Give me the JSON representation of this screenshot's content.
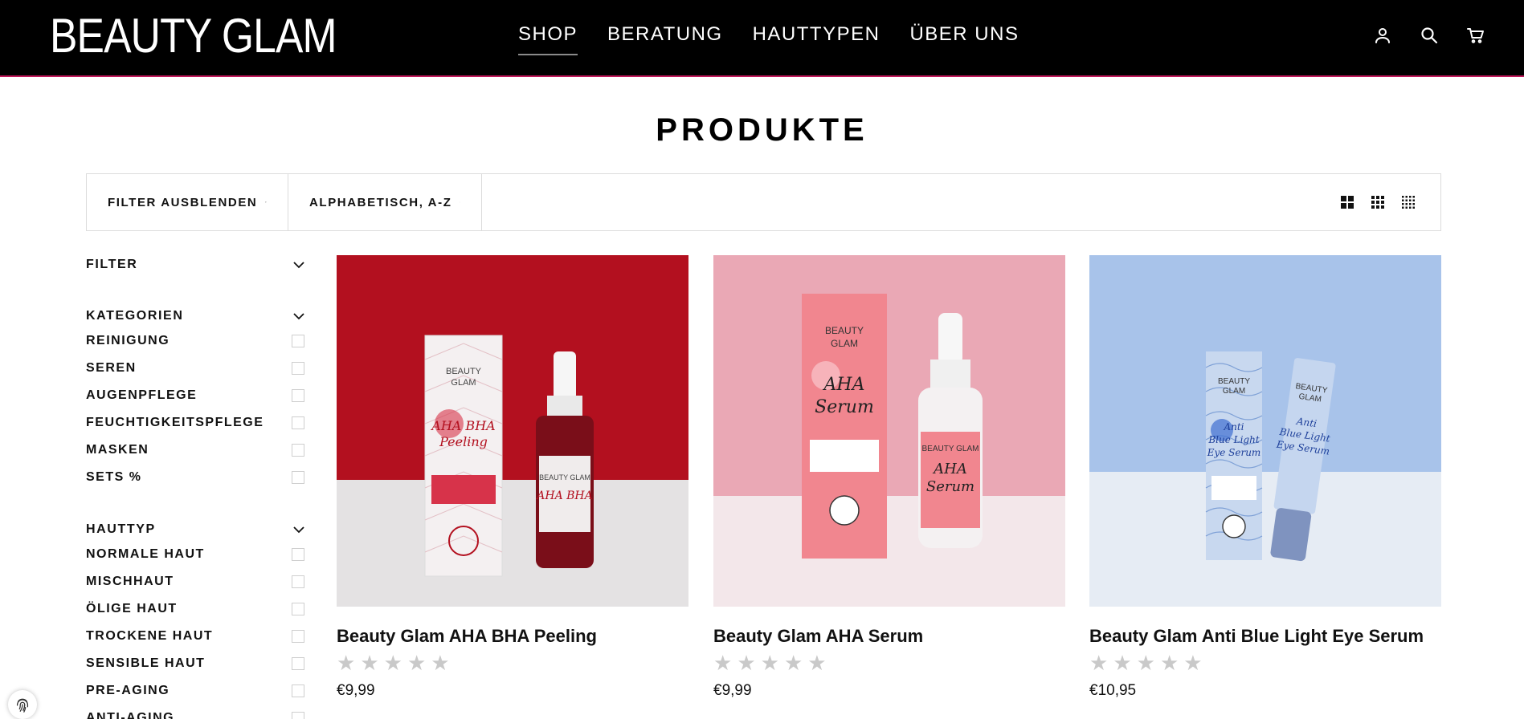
{
  "brand": {
    "logo": "BEAUTY GLAM"
  },
  "nav": {
    "items": [
      {
        "label": "SHOP",
        "active": true
      },
      {
        "label": "BERATUNG"
      },
      {
        "label": "HAUTTYPEN"
      },
      {
        "label": "ÜBER UNS"
      }
    ]
  },
  "header_icons": [
    "account-icon",
    "search-icon",
    "cart-icon"
  ],
  "page": {
    "title": "PRODUKTE"
  },
  "toolbar": {
    "filter_label": "FILTER AUSBLENDEN",
    "sort_label": "ALPHABETISCH, A-Z",
    "grid_options": [
      "grid-large-icon",
      "grid-medium-icon",
      "grid-small-icon"
    ]
  },
  "sidebar": {
    "filter_heading": "FILTER",
    "categories": {
      "heading": "KATEGORIEN",
      "items": [
        "REINIGUNG",
        "SEREN",
        "AUGENPFLEGE",
        "FEUCHTIGKEITSPFLEGE",
        "MASKEN",
        "SETS %"
      ]
    },
    "skin_type": {
      "heading": "HAUTTYP",
      "items": [
        "NORMALE HAUT",
        "MISCHHAUT",
        "ÖLIGE HAUT",
        "TROCKENE HAUT",
        "SENSIBLE HAUT",
        "PRE-AGING",
        "ANTI-AGING"
      ]
    }
  },
  "products": [
    {
      "title": "Beauty Glam AHA BHA Peeling",
      "price": "€9,99",
      "rating": 0,
      "image": {
        "bg": "#b3101f",
        "box_brand": "BEAUTY\nGLAM",
        "box_text": "AHA BHA\nPeeling",
        "bottle_text": "AHA BHA"
      }
    },
    {
      "title": "Beauty Glam AHA Serum",
      "price": "€9,99",
      "rating": 0,
      "image": {
        "bg": "#eaa8b5",
        "box_brand": "BEAUTY\nGLAM",
        "box_text": "AHA\nSerum",
        "bottle_text": "AHA\nSerum"
      }
    },
    {
      "title": "Beauty Glam Anti Blue Light Eye Serum",
      "price": "€10,95",
      "rating": 0,
      "image": {
        "bg": "#a8c3ea",
        "box_brand": "BEAUTY\nGLAM",
        "box_text": "Anti\nBlue Light\nEye Serum",
        "bottle_text": "Anti\nBlue Light\nEye Serum"
      }
    }
  ],
  "colors": {
    "header_bg": "#000000",
    "header_accent": "#c2185b",
    "star_empty": "#c9c9c9"
  }
}
